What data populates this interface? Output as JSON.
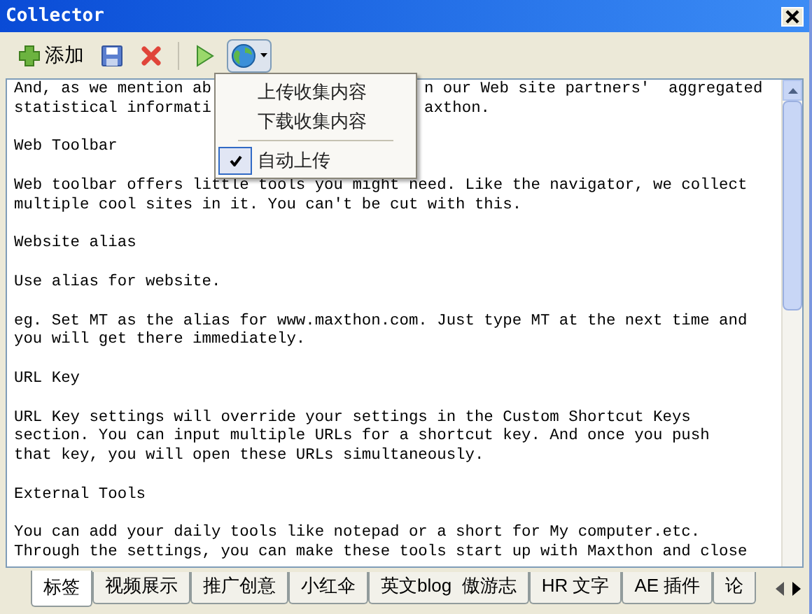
{
  "window": {
    "title": "Collector"
  },
  "toolbar": [
    {
      "kind": "add",
      "label": "添加"
    },
    {
      "kind": "save"
    },
    {
      "kind": "delete"
    },
    {
      "kind": "separator"
    },
    {
      "kind": "play"
    },
    {
      "kind": "globe",
      "pressed": true
    }
  ],
  "menu": [
    {
      "kind": "item",
      "label": "上传收集内容",
      "checked": false
    },
    {
      "kind": "item",
      "label": "下载收集内容",
      "checked": false
    },
    {
      "kind": "separator"
    },
    {
      "kind": "item",
      "label": "自动上传",
      "checked": true
    }
  ],
  "paragraphs": [
    [
      [
        "And, as we mention ab",
        "n our Web site partners'  aggregated"
      ],
      [
        "statistical informati",
        "axthon."
      ]
    ],
    [
      "Web Toolbar"
    ],
    [
      "Web toolbar offers little tools you might need. Like the navigator, we collect",
      "multiple cool sites in it. You can't be cut with this."
    ],
    [
      "Website alias"
    ],
    [
      "Use alias for website."
    ],
    [
      "eg. Set MT as the alias for www.maxthon.com. Just type MT at the next time and",
      "you will get there immediately."
    ],
    [
      "URL Key"
    ],
    [
      "URL Key settings will override your settings in the Custom Shortcut Keys",
      "section. You can input multiple URLs for a shortcut key. And once you push",
      "that key, you will open these URLs simultaneously."
    ],
    [
      "External Tools"
    ],
    [
      "You can add your daily tools like notepad or a short for My computer.etc.",
      "Through the settings, you can make these tools start up with Maxthon and close"
    ]
  ],
  "tabs": [
    {
      "label": "标签",
      "selected": true
    },
    {
      "label": "视频展示",
      "selected": false
    },
    {
      "label": "推广创意",
      "selected": false
    },
    {
      "label": "小红伞",
      "selected": false
    },
    {
      "label": "英文blog  傲游志",
      "selected": false
    },
    {
      "label": "HR 文字",
      "selected": false
    },
    {
      "label": "AE 插件",
      "selected": false
    },
    {
      "label": "论",
      "selected": false
    }
  ]
}
